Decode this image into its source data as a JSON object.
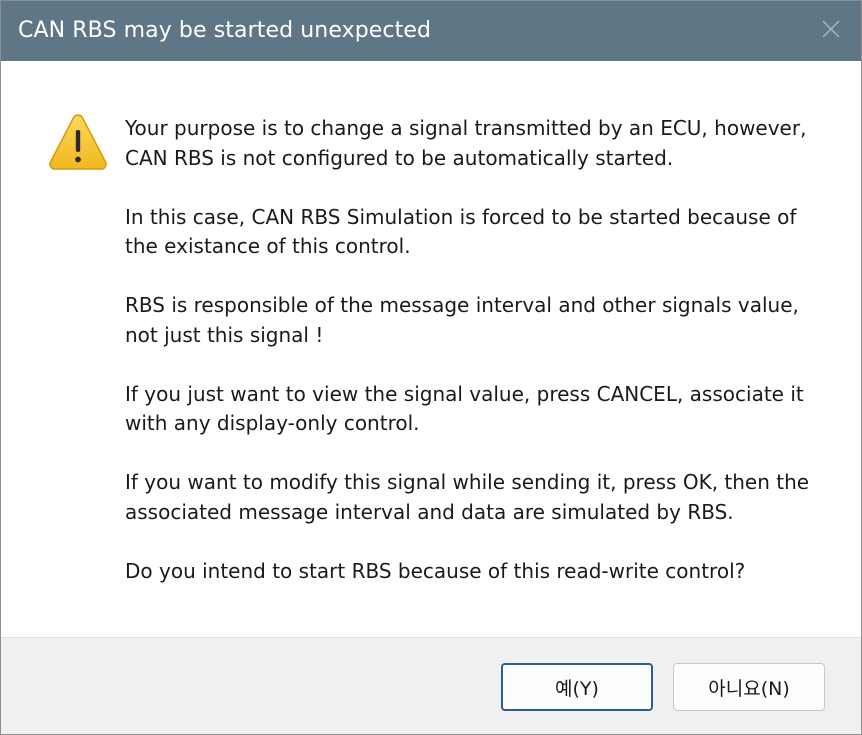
{
  "window": {
    "title": "CAN RBS may be started unexpected",
    "close_icon": "close-icon"
  },
  "dialog": {
    "icon": "warning-icon",
    "paragraphs": [
      {
        "line1": "Your purpose is to change a signal transmitted by an ECU, however,",
        "line2": "CAN RBS is not configured to be automatically started."
      },
      {
        "line1": "In this case, CAN RBS Simulation is forced to be started because of",
        "line2": "the existance of this control."
      },
      {
        "line1": "RBS is responsible of the message interval and other signals value,",
        "line2": "not just this signal !"
      },
      {
        "line1": "If you just want to view the signal value, press CANCEL, associate it",
        "line2": "with any display-only control."
      },
      {
        "line1": "If you want to modify this signal while sending it, press OK, then the",
        "line2": "associated message interval and data are simulated by RBS."
      }
    ],
    "question": "Do you intend to start RBS because of this read-write control?"
  },
  "buttons": {
    "yes_label": "예(Y)",
    "no_label": "아니요(N)"
  },
  "colors": {
    "titlebar": "#5f7686",
    "warning_fill": "#f7c948",
    "default_button_border": "#2d5f8a"
  }
}
